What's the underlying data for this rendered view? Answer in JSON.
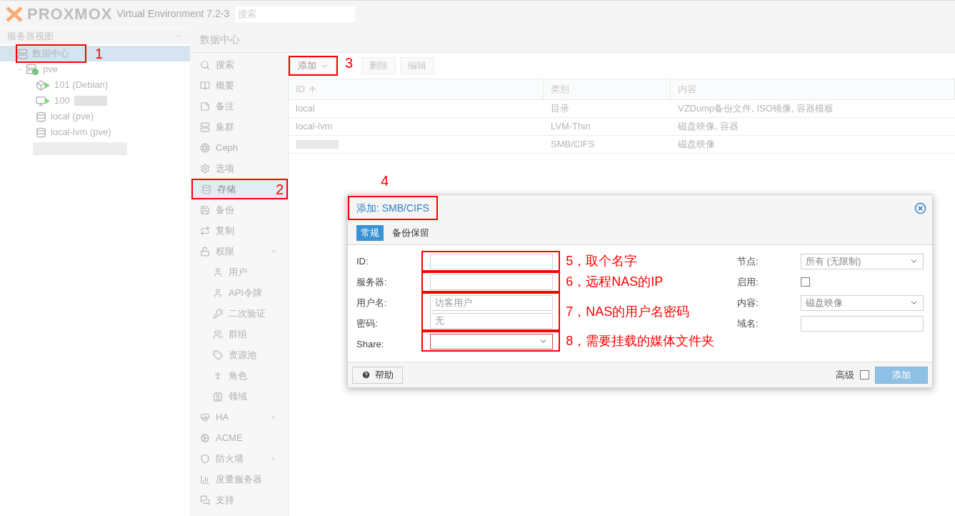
{
  "header": {
    "logo": "PROXMOX",
    "version": "Virtual Environment 7.2-3",
    "search": {
      "placeholder": "搜索"
    }
  },
  "tree": {
    "view": "服务器视图",
    "items": [
      {
        "kind": "datacenter",
        "label": "数据中心",
        "selected": true,
        "expanded": true,
        "note": "1",
        "children": [
          {
            "kind": "node",
            "label": "pve",
            "selected": false,
            "expanded": true,
            "children": [
              {
                "kind": "container",
                "label": "101 (Debian)",
                "selected": false
              },
              {
                "kind": "vm",
                "label": "100",
                "selected": false,
                "redacted": true
              },
              {
                "kind": "storage",
                "label": "local (pve)",
                "selected": false
              },
              {
                "kind": "storage",
                "label": "local-lvm (pve)",
                "selected": false
              }
            ]
          }
        ]
      },
      {
        "kind": "redacted"
      }
    ]
  },
  "breadcrumb": "数据中心",
  "nav": [
    {
      "label": "搜索",
      "selected": false
    },
    {
      "label": "概要",
      "selected": false
    },
    {
      "label": "备注",
      "selected": false
    },
    {
      "label": "集群",
      "selected": false
    },
    {
      "label": "Ceph",
      "selected": false
    },
    {
      "label": "选项",
      "selected": false
    },
    {
      "label": "存储",
      "selected": true,
      "note": "2"
    },
    {
      "label": "备份",
      "selected": false
    },
    {
      "label": "复制",
      "selected": false
    },
    {
      "label": "权限",
      "selected": false,
      "expanded": true,
      "children": [
        {
          "label": "用户",
          "selected": false
        },
        {
          "label": "API令牌",
          "selected": false
        },
        {
          "label": "二次验证",
          "selected": false
        },
        {
          "label": "群组",
          "selected": false
        },
        {
          "label": "资源池",
          "selected": false
        },
        {
          "label": "角色",
          "selected": false
        },
        {
          "label": "领域",
          "selected": false
        }
      ]
    },
    {
      "label": "HA",
      "selected": false,
      "expanded": false
    },
    {
      "label": "ACME",
      "selected": false
    },
    {
      "label": "防火墙",
      "selected": false,
      "expanded": false
    },
    {
      "label": "度量服务器",
      "selected": false
    },
    {
      "label": "支持",
      "selected": false
    }
  ],
  "toolbar": [
    {
      "label": "添加",
      "kind": "menu",
      "disabled": false,
      "note": "3"
    },
    {
      "label": "删除",
      "kind": "plain",
      "disabled": true
    },
    {
      "label": "编辑",
      "kind": "plain",
      "disabled": true
    }
  ],
  "table": {
    "columns": [
      {
        "label": "ID",
        "sorted": true
      },
      {
        "label": "类别",
        "sorted": false
      },
      {
        "label": "内容",
        "sorted": false
      }
    ],
    "rows": [
      {
        "id": "local",
        "type": "目录",
        "content": "VZDump备份文件, ISO镜像, 容器模板"
      },
      {
        "id": "local-lvm",
        "type": "LVM-Thin",
        "content": "磁盘映像, 容器"
      },
      {
        "redacted": true,
        "type": "SMB/CIFS",
        "content": "磁盘映像"
      }
    ]
  },
  "dialog": {
    "title": "添加: SMB/CIFS",
    "note": "4",
    "tabs": [
      {
        "label": "常规",
        "selected": true
      },
      {
        "label": "备份保留",
        "selected": false
      }
    ],
    "left": [
      {
        "label": "ID:",
        "kind": "text",
        "note": "5，取个名字"
      },
      {
        "label": "服务器:",
        "kind": "text",
        "note": "6，远程NAS的IP"
      },
      {
        "label": "用户名:",
        "kind": "text",
        "placeholder": "访客用户",
        "note": "7，NAS的用户名密码"
      },
      {
        "label": "密码:",
        "kind": "text",
        "placeholder": "无"
      },
      {
        "label": "Share:",
        "kind": "select",
        "invalid": true,
        "note": "8，需要挂载的媒体文件夹"
      }
    ],
    "right": [
      {
        "label": "节点:",
        "kind": "select",
        "value": "所有 (无限制)"
      },
      {
        "label": "启用:",
        "kind": "checkbox",
        "checked": false
      },
      {
        "label": "内容:",
        "kind": "select",
        "value": "磁盘映像"
      },
      {
        "label": "域名:",
        "kind": "text"
      }
    ],
    "help": "帮助",
    "advanced": {
      "label": "高级",
      "checked": false
    },
    "submit": {
      "label": "添加",
      "disabled": true
    }
  }
}
